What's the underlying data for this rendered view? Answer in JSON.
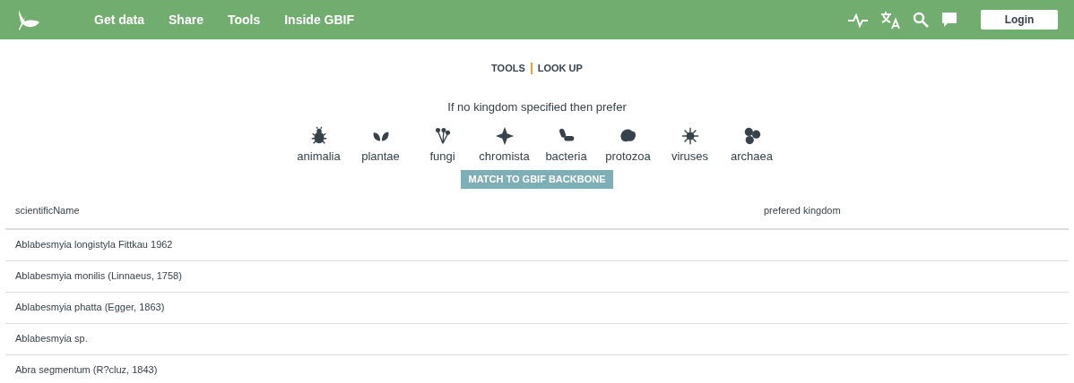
{
  "nav": {
    "items": [
      "Get data",
      "Share",
      "Tools",
      "Inside GBIF"
    ],
    "login": "Login"
  },
  "breadcrumb": [
    "TOOLS",
    "LOOK UP"
  ],
  "prompt": "If no kingdom specified then prefer",
  "kingdoms": [
    "animalia",
    "plantae",
    "fungi",
    "chromista",
    "bacteria",
    "protozoa",
    "viruses",
    "archaea"
  ],
  "match_button": "MATCH TO GBIF BACKBONE",
  "table": {
    "columns": [
      "scientificName",
      "prefered kingdom"
    ],
    "rows": [
      [
        "Ablabesmyia longistyla Fittkau 1962"
      ],
      [
        "Ablabesmyia monilis (Linnaeus, 1758)"
      ],
      [
        "Ablabesmyia phatta (Egger, 1863)"
      ],
      [
        "Ablabesmyia sp."
      ],
      [
        "Abra segmentum (R?cluz, 1843)"
      ]
    ]
  }
}
